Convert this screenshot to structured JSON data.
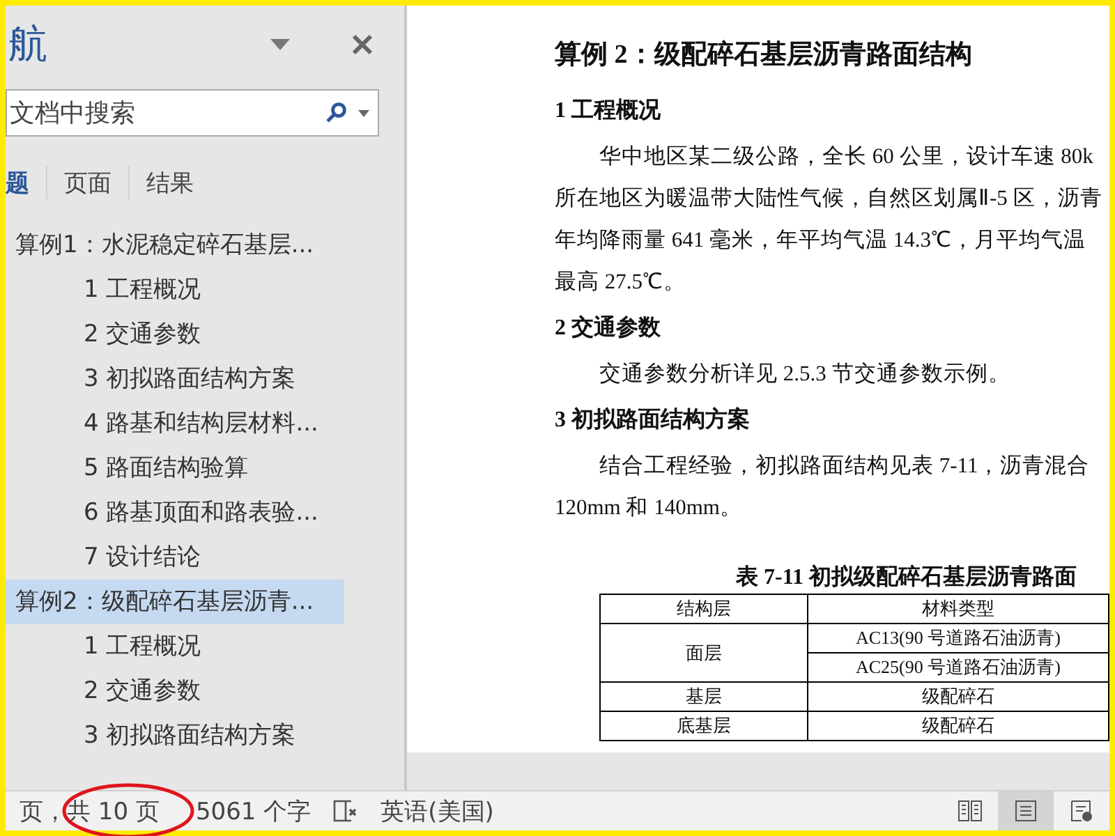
{
  "nav_pane": {
    "title": "航",
    "search": {
      "placeholder": "文档中搜索"
    },
    "tabs": [
      {
        "label": "题",
        "selected": true
      },
      {
        "label": "页面",
        "selected": false
      },
      {
        "label": "结果",
        "selected": false
      }
    ],
    "tree": [
      {
        "label": "算例1：水泥稳定碎石基层...",
        "selected": false,
        "children": [
          {
            "label": "1 工程概况",
            "selected": false
          },
          {
            "label": "2 交通参数",
            "selected": false
          },
          {
            "label": "3 初拟路面结构方案",
            "selected": false
          },
          {
            "label": "4 路基和结构层材料...",
            "selected": false
          },
          {
            "label": "5 路面结构验算",
            "selected": false
          },
          {
            "label": "6 路基顶面和路表验...",
            "selected": false
          },
          {
            "label": "7 设计结论",
            "selected": false
          }
        ]
      },
      {
        "label": "算例2：级配碎石基层沥青...",
        "selected": true,
        "children": [
          {
            "label": "1 工程概况",
            "selected": false
          },
          {
            "label": "2 交通参数",
            "selected": false
          },
          {
            "label": "3 初拟路面结构方案",
            "selected": false
          }
        ]
      }
    ]
  },
  "document": {
    "blocks": [
      {
        "kind": "title",
        "text": "算例 2：级配碎石基层沥青路面结构"
      },
      {
        "kind": "heading",
        "text": "1  工程概况"
      },
      {
        "kind": "para",
        "lines": [
          "　　华中地区某二级公路，全长 60 公里，设计车速 80k",
          "所在地区为暖温带大陆性气候，自然区划属Ⅱ-5 区，沥青",
          "年均降雨量 641 毫米，年平均气温 14.3℃，月平均气温",
          "最高 27.5℃。"
        ]
      },
      {
        "kind": "heading",
        "text": "2  交通参数"
      },
      {
        "kind": "para",
        "lines": [
          "　　交通参数分析详见 2.5.3 节交通参数示例。"
        ]
      },
      {
        "kind": "heading",
        "text": "3  初拟路面结构方案"
      },
      {
        "kind": "para",
        "lines": [
          "　　结合工程经验，初拟路面结构见表 7-11，沥青混合",
          "120mm 和 140mm。"
        ]
      }
    ],
    "table": {
      "caption": "表 7-11  初拟级配碎石基层沥青路面",
      "columns": [
        "结构层",
        "材料类型"
      ],
      "rows": [
        {
          "layer": "面层",
          "materials": [
            "AC13(90 号道路石油沥青)",
            "AC25(90 号道路石油沥青)"
          ]
        },
        {
          "layer": "基层",
          "materials": [
            "级配碎石"
          ]
        },
        {
          "layer": "底基层",
          "materials": [
            "级配碎石"
          ]
        }
      ]
    }
  },
  "status_bar": {
    "page": "页，共 10 页",
    "words": "5061 个字",
    "language": "英语(美国)",
    "views": [
      {
        "kind": "read",
        "selected": false
      },
      {
        "kind": "print",
        "selected": true
      },
      {
        "kind": "web",
        "selected": false
      }
    ]
  }
}
